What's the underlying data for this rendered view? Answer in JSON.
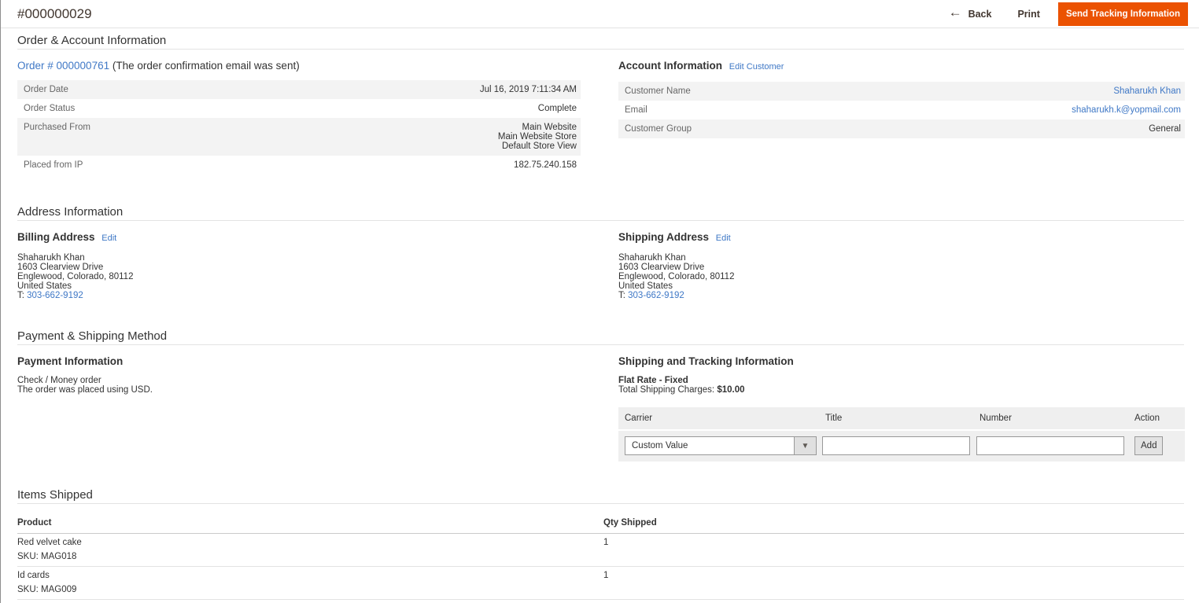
{
  "header": {
    "title": "#000000029",
    "back_label": "Back",
    "print_label": "Print",
    "send_tracking_label": "Send Tracking Information",
    "accent_color": "#eb5202"
  },
  "order_account": {
    "section_title": "Order & Account Information",
    "order": {
      "title_link": "Order # 000000761",
      "title_note": "(The order confirmation email was sent)",
      "rows": [
        {
          "label": "Order Date",
          "value": "Jul 16, 2019 7:11:34 AM"
        },
        {
          "label": "Order Status",
          "value": "Complete"
        },
        {
          "label": "Purchased From",
          "value_lines": [
            "Main Website",
            "Main Website Store",
            "Default Store View"
          ]
        },
        {
          "label": "Placed from IP",
          "value": "182.75.240.158"
        }
      ]
    },
    "account": {
      "title": "Account Information",
      "edit_link": "Edit Customer",
      "rows": [
        {
          "label": "Customer Name",
          "value": "Shaharukh Khan"
        },
        {
          "label": "Email",
          "value": "shaharukh.k@yopmail.com"
        },
        {
          "label": "Customer Group",
          "value": "General"
        }
      ]
    }
  },
  "address": {
    "section_title": "Address Information",
    "billing": {
      "title": "Billing Address",
      "edit_link": "Edit",
      "lines": [
        "Shaharukh Khan",
        "1603 Clearview Drive",
        "Englewood, Colorado, 80112",
        "United States"
      ],
      "phone_prefix": "T: ",
      "phone": "303-662-9192"
    },
    "shipping": {
      "title": "Shipping Address",
      "edit_link": "Edit",
      "lines": [
        "Shaharukh Khan",
        "1603 Clearview Drive",
        "Englewood, Colorado, 80112",
        "United States"
      ],
      "phone_prefix": "T: ",
      "phone": "303-662-9192"
    }
  },
  "payment_shipping": {
    "section_title": "Payment & Shipping Method",
    "payment": {
      "title": "Payment Information",
      "method": "Check / Money order",
      "note": "The order was placed using USD."
    },
    "shipping": {
      "title": "Shipping and Tracking Information",
      "method": "Flat Rate - Fixed",
      "charges_label": "Total Shipping Charges: ",
      "charges_value": "$10.00",
      "table": {
        "col_carrier": "Carrier",
        "col_title": "Title",
        "col_number": "Number",
        "col_action": "Action",
        "carrier_selected": "Custom Value",
        "add_label": "Add"
      }
    }
  },
  "items": {
    "section_title": "Items Shipped",
    "col_product": "Product",
    "col_qty": "Qty Shipped",
    "rows": [
      {
        "product": "Red velvet cake",
        "sku": "SKU: MAG018",
        "qty": "1"
      },
      {
        "product": "Id cards",
        "sku": "SKU: MAG009",
        "qty": "1"
      }
    ]
  }
}
